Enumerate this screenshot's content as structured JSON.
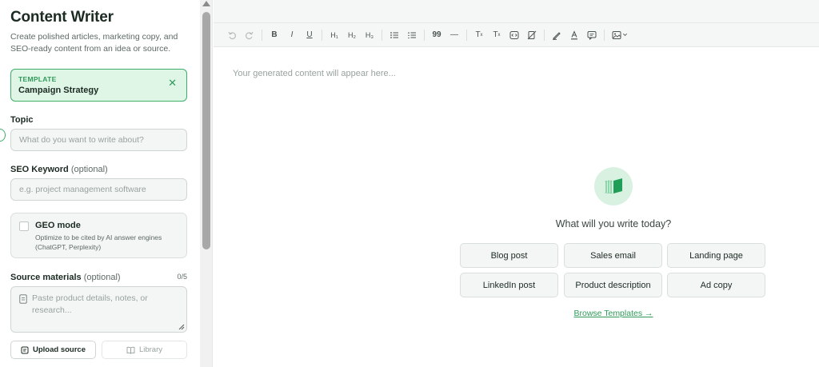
{
  "sidebar": {
    "title": "Content Writer",
    "description": "Create polished articles, marketing copy, and SEO-ready content from an idea or source.",
    "template": {
      "label": "TEMPLATE",
      "name": "Campaign Strategy",
      "close": "✕"
    },
    "topic": {
      "label": "Topic",
      "placeholder": "What do you want to write about?"
    },
    "seo": {
      "label": "SEO Keyword",
      "optional": "(optional)",
      "placeholder": "e.g. project management software"
    },
    "geo": {
      "title": "GEO mode",
      "description": "Optimize to be cited by AI answer engines (ChatGPT, Perplexity)"
    },
    "source": {
      "label": "Source materials",
      "optional": "(optional)",
      "count": "0/5",
      "placeholder": "Paste product details, notes, or research..."
    },
    "upload_label": "Upload source",
    "library_label": "Library"
  },
  "toolbar": {
    "h1": "H₁",
    "h2": "H₂",
    "h3": "H₃",
    "bold": "B",
    "italic": "I",
    "underline": "U",
    "quote": "99",
    "hr": "—",
    "superscript": "T",
    "subscript": "T"
  },
  "editor": {
    "placeholder": "Your generated content will appear here...",
    "question": "What will you write today?",
    "chips": [
      "Blog post",
      "Sales email",
      "Landing page",
      "LinkedIn post",
      "Product description",
      "Ad copy"
    ],
    "browse": "Browse Templates →"
  },
  "colors": {
    "accent": "#3fae6a",
    "accent_bg": "#dff5e6",
    "hero_bg": "#d9f1e1",
    "link": "#2f9a5a"
  }
}
